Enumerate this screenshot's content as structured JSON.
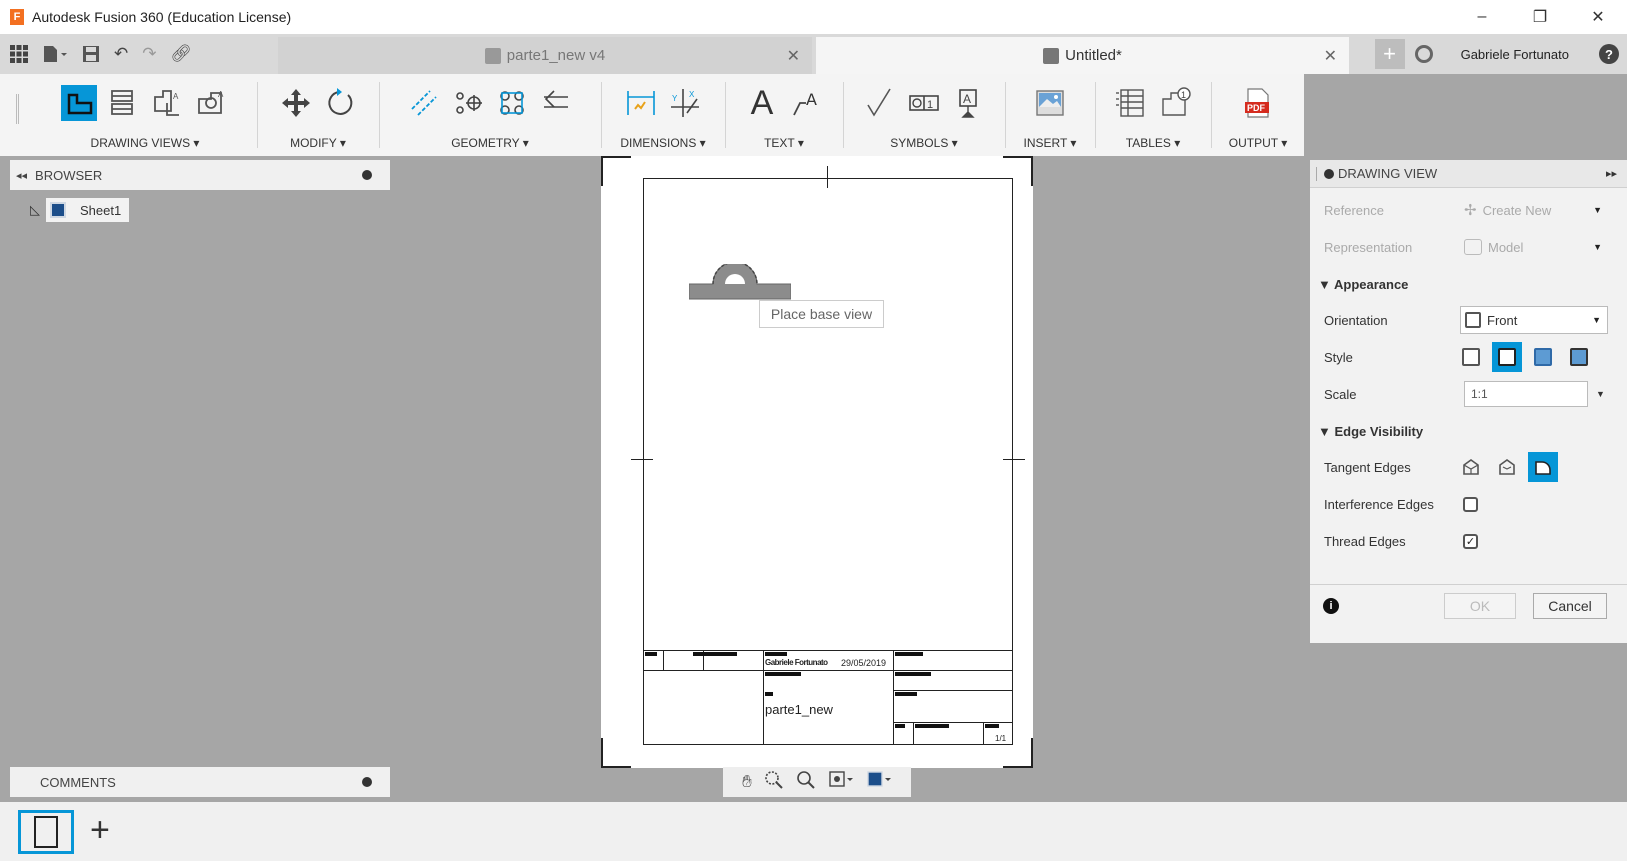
{
  "window": {
    "title": "Autodesk Fusion 360 (Education License)",
    "logo_letter": "F",
    "minimize": "–",
    "restore": "❐",
    "close": "✕"
  },
  "tabs": [
    {
      "label": "parte1_new v4",
      "active": false
    },
    {
      "label": "Untitled*",
      "active": true
    }
  ],
  "tab_close": "✕",
  "user": {
    "name": "Gabriele Fortunato"
  },
  "ribbon": {
    "groups": [
      {
        "label": "DRAWING VIEWS ▾"
      },
      {
        "label": "MODIFY ▾"
      },
      {
        "label": "GEOMETRY ▾"
      },
      {
        "label": "DIMENSIONS ▾"
      },
      {
        "label": "TEXT ▾"
      },
      {
        "label": "SYMBOLS ▾"
      },
      {
        "label": "INSERT ▾"
      },
      {
        "label": "TABLES ▾"
      },
      {
        "label": "OUTPUT ▾"
      }
    ],
    "text_icon": "A",
    "pdf_label": "PDF"
  },
  "browser": {
    "title": "BROWSER",
    "items": [
      {
        "label": "Sheet1"
      }
    ]
  },
  "comments": {
    "title": "COMMENTS"
  },
  "canvas": {
    "tooltip": "Place base view"
  },
  "title_block": {
    "author_date": "29/05/2019",
    "author_name": "Gabriele Fortunato",
    "part_name": "parte1_new",
    "sheet_count": "1/1"
  },
  "drawing_view_panel": {
    "title": "DRAWING VIEW",
    "reference_label": "Reference",
    "reference_value": "Create New",
    "representation_label": "Representation",
    "representation_value": "Model",
    "appearance_header": "▼ Appearance",
    "orientation_label": "Orientation",
    "orientation_value": "Front",
    "style_label": "Style",
    "scale_label": "Scale",
    "scale_value": "1:1",
    "edge_visibility_header": "▼ Edge Visibility",
    "tangent_edges_label": "Tangent Edges",
    "interference_edges_label": "Interference Edges",
    "interference_edges_checked": false,
    "thread_edges_label": "Thread Edges",
    "thread_edges_checked": true,
    "ok_label": "OK",
    "cancel_label": "Cancel"
  },
  "colors": {
    "accent": "#0696d7",
    "background": "#a6a6a6"
  }
}
